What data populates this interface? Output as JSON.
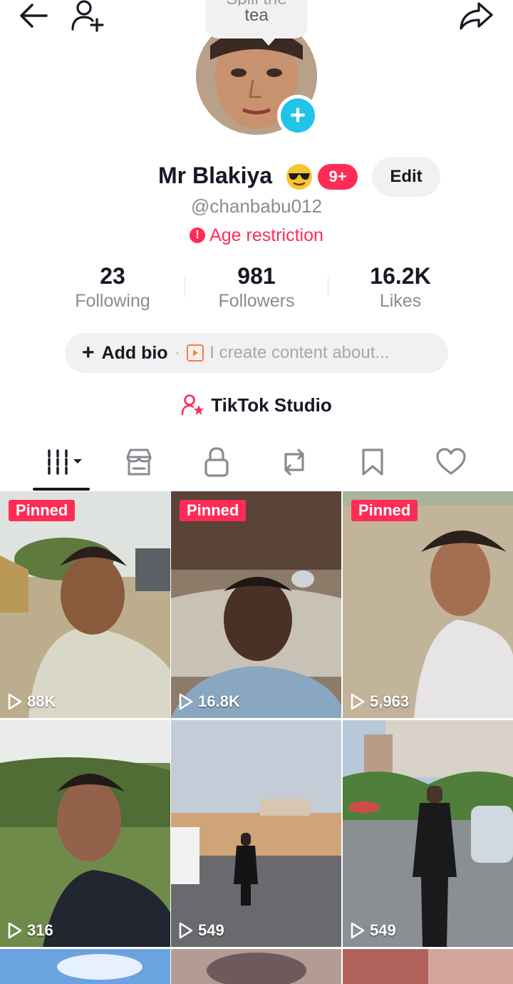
{
  "top_bar": {
    "bubble_line1": "Spill the",
    "bubble_line2": "tea"
  },
  "profile": {
    "display_name": "Mr Blakiya",
    "notification_badge": "9+",
    "edit_label": "Edit",
    "username": "@chanbabu012",
    "age_restriction": "Age restriction"
  },
  "stats": [
    {
      "value": "23",
      "label": "Following"
    },
    {
      "value": "981",
      "label": "Followers"
    },
    {
      "value": "16.2K",
      "label": "Likes"
    }
  ],
  "bio": {
    "add_label": "Add bio",
    "suggestion": "I create content about..."
  },
  "studio": {
    "label": "TikTok Studio"
  },
  "tabs": [
    {
      "icon": "grid-icon"
    },
    {
      "icon": "shop-icon"
    },
    {
      "icon": "lock-icon"
    },
    {
      "icon": "repost-icon"
    },
    {
      "icon": "bookmark-icon"
    },
    {
      "icon": "heart-icon"
    }
  ],
  "videos": [
    {
      "pinned": "Pinned",
      "views": "88K"
    },
    {
      "pinned": "Pinned",
      "views": "16.8K"
    },
    {
      "pinned": "Pinned",
      "views": "5,963"
    },
    {
      "pinned": "",
      "views": "316"
    },
    {
      "pinned": "",
      "views": "549"
    },
    {
      "pinned": "",
      "views": "549"
    }
  ],
  "colors": {
    "accent": "#fe2c55",
    "avatar_add": "#20c4e8",
    "text_primary": "#161823",
    "text_secondary": "#8a8b91"
  }
}
